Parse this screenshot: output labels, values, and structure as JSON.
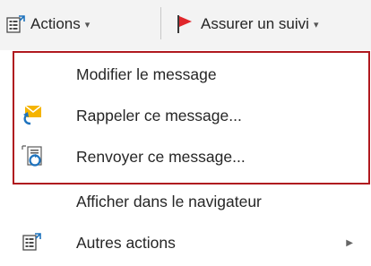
{
  "toolbar": {
    "actions_label": "Actions",
    "followup_label": "Assurer un suivi",
    "caret": "▾"
  },
  "menu": {
    "items": [
      {
        "label": "Modifier le message",
        "icon": "none"
      },
      {
        "label": "Rappeler ce message...",
        "icon": "recall-message-icon"
      },
      {
        "label": "Renvoyer ce message...",
        "icon": "resend-message-icon"
      },
      {
        "label": "Afficher dans le navigateur",
        "icon": "none"
      },
      {
        "label": "Autres actions",
        "icon": "other-actions-icon",
        "submenu_arrow": "▶"
      }
    ]
  },
  "colors": {
    "highlight_border": "#b0191f",
    "flag": "#e0262b",
    "envelope": "#f5b400",
    "arrow": "#1e73be"
  }
}
